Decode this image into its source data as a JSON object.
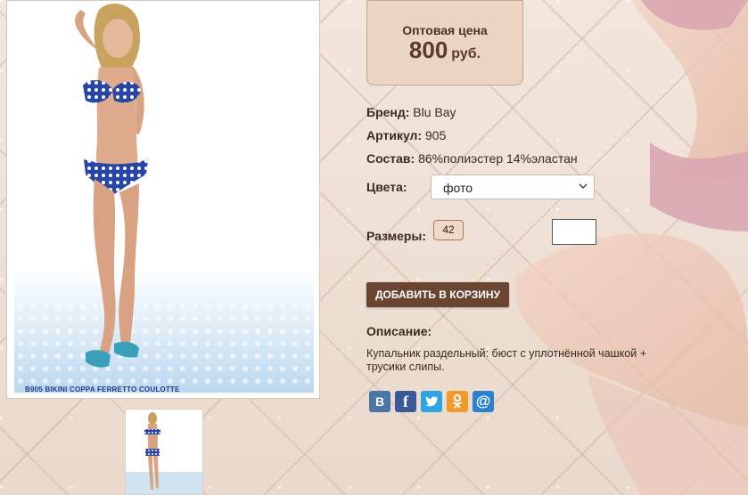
{
  "price": {
    "label": "Оптовая цена",
    "value": "800",
    "currency": "руб."
  },
  "product": {
    "brand_label": "Бренд:",
    "brand": "Blu Bay",
    "article_label": "Артикул:",
    "article": "905",
    "composition_label": "Состав:",
    "composition": "86%полиэстер 14%эластан",
    "colors_label": "Цвета:",
    "color_selected": "фото",
    "sizes_label": "Размеры:",
    "size": "42",
    "quantity": ""
  },
  "image_caption": "B905 BIKINI COPPA FERRETTO COULOTTE",
  "cart_button": "ДОБАВИТЬ В КОРЗИНУ",
  "description": {
    "label": "Описание:",
    "text": "Купальник раздельный: бюст с уплотнённой чашкой + трусики слипы."
  },
  "social": [
    {
      "name": "vk",
      "glyph": "B",
      "color": "#4a76a8"
    },
    {
      "name": "facebook",
      "glyph": "f",
      "color": "#3b5998"
    },
    {
      "name": "twitter",
      "glyph": "t",
      "color": "#2ea4e2"
    },
    {
      "name": "odnoklassniki",
      "glyph": "ok",
      "color": "#f2992a"
    },
    {
      "name": "mail",
      "glyph": "@",
      "color": "#2b83d0"
    }
  ],
  "colors": {
    "accent": "#6a4632",
    "price_bg": "#ecd4c2"
  }
}
